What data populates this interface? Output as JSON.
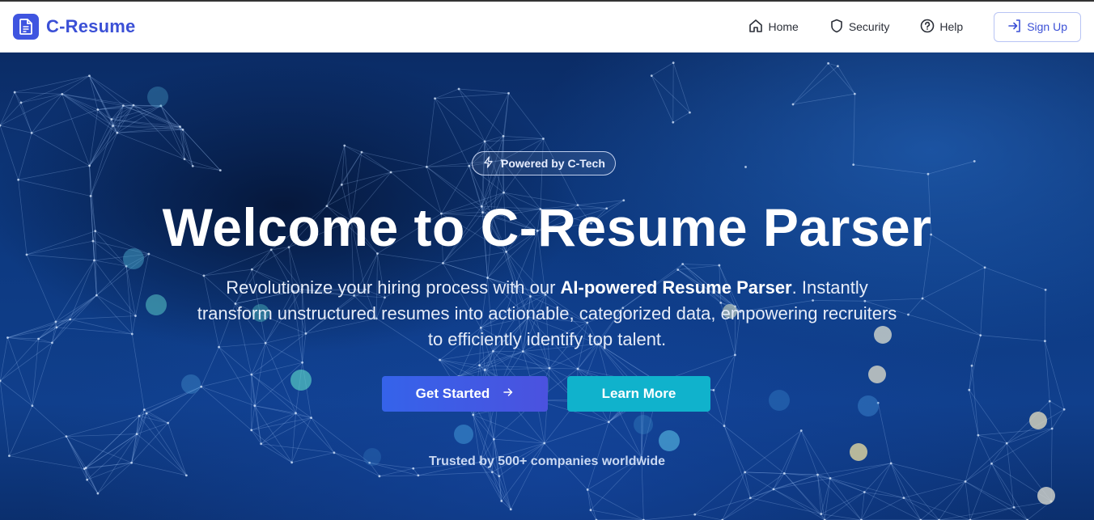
{
  "brand": {
    "name": "C-Resume",
    "icon": "document-icon"
  },
  "nav": {
    "home": {
      "label": "Home",
      "icon": "home-icon"
    },
    "security": {
      "label": "Security",
      "icon": "shield-icon"
    },
    "help": {
      "label": "Help",
      "icon": "help-circle-icon"
    },
    "signup": {
      "label": "Sign Up",
      "icon": "sign-in-arrow-icon"
    }
  },
  "hero": {
    "badge": "Powered by C-Tech",
    "title": "Welcome to C-Resume Parser",
    "subtitle_pre": "Revolutionize your hiring process with our ",
    "subtitle_highlight": "AI-powered Resume Parser",
    "subtitle_post": ". Instantly transform unstructured resumes into actionable, categorized data, empowering recruiters to efficiently identify top talent.",
    "primary_button": "Get Started",
    "secondary_button": "Learn More",
    "trusted": "Trusted by 500+ companies worldwide"
  },
  "colors": {
    "brand": "#3b50d6",
    "primary_button": "#3f5be6",
    "secondary_button": "#10b2cc",
    "hero_background": "#0d3a82"
  }
}
